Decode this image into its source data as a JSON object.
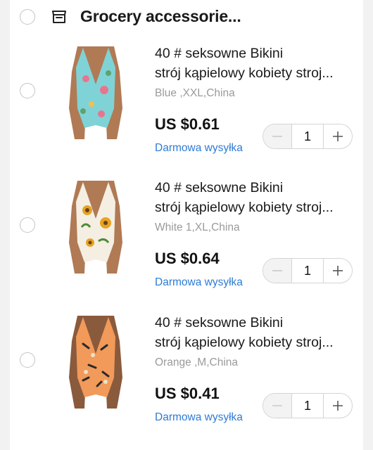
{
  "store": {
    "name": "Grocery accessorie..."
  },
  "items": [
    {
      "title_line1": "40 # seksowne Bikini",
      "title_line2": "strój kąpielowy kobiety stroj...",
      "variant": "Blue ,XXL,China",
      "price": "US $0.61",
      "shipping": "Darmowa wysyłka",
      "quantity": "1",
      "print_color": "#7fd3d6"
    },
    {
      "title_line1": "40 # seksowne Bikini",
      "title_line2": "strój kąpielowy kobiety stroj...",
      "variant": "White 1,XL,China",
      "price": "US $0.64",
      "shipping": "Darmowa wysyłka",
      "quantity": "1",
      "print_color": "#f4efe2"
    },
    {
      "title_line1": "40 # seksowne Bikini",
      "title_line2": "strój kąpielowy kobiety stroj...",
      "variant": "Orange ,M,China",
      "price": "US $0.41",
      "shipping": "Darmowa wysyłka",
      "quantity": "1",
      "print_color": "#f29a5a"
    }
  ],
  "colors": {
    "link_blue": "#2d7bd4",
    "muted_text": "#9a9a9a",
    "background": "#f2f2f2"
  },
  "icons": {
    "store": "store-icon",
    "minus": "minus-icon",
    "plus": "plus-icon",
    "radio": "radio-button"
  }
}
